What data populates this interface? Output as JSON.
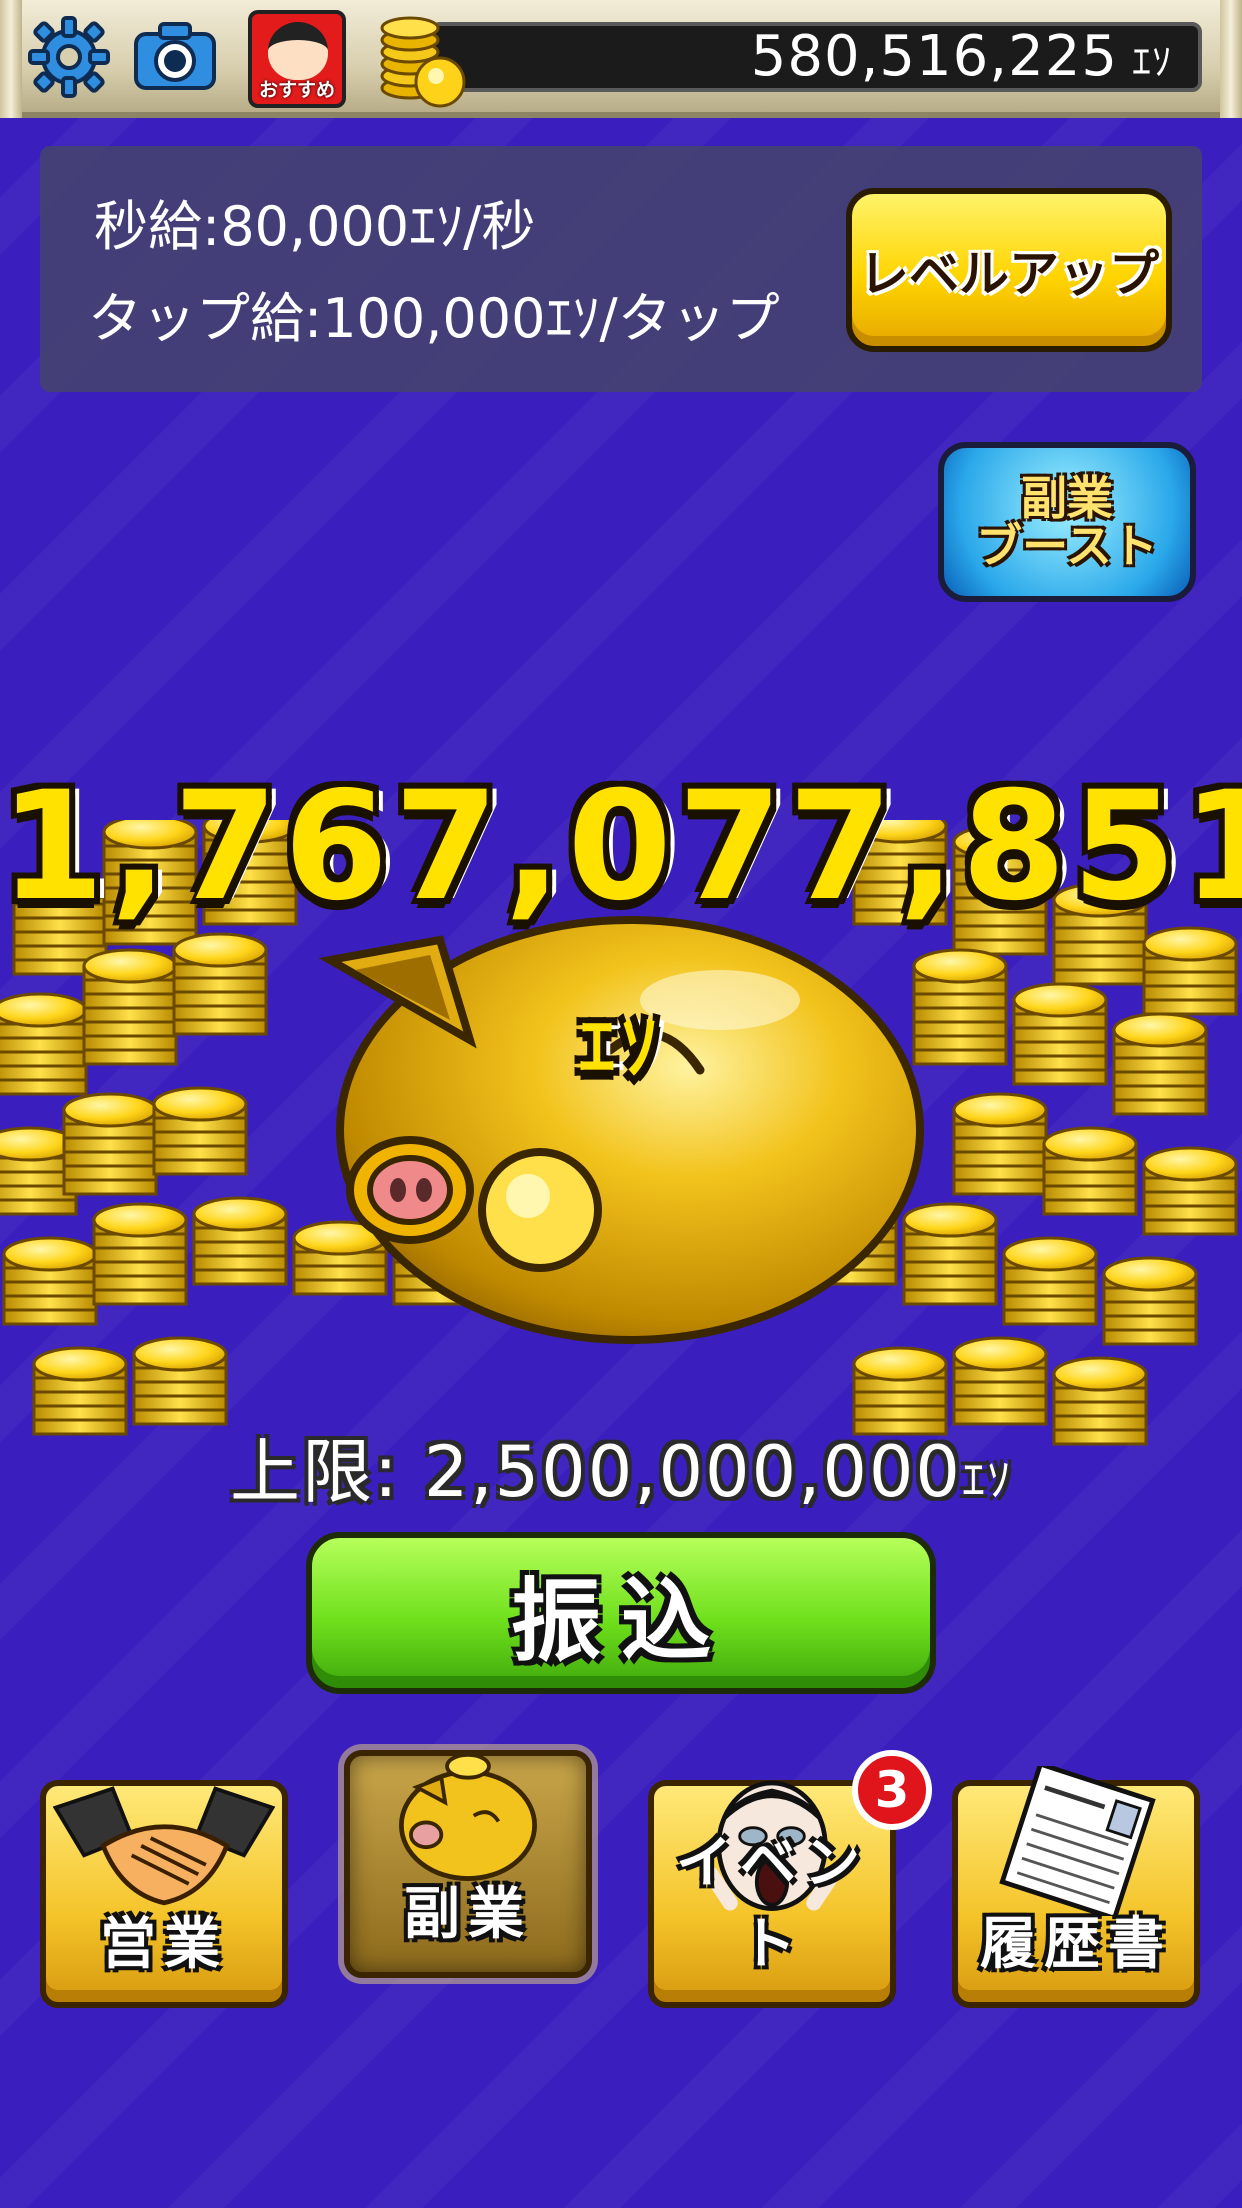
{
  "top_bar": {
    "recommend_label": "おすすめ",
    "money_value": "580,516,225",
    "money_unit": "ｴｿ"
  },
  "stats": {
    "per_second": "秒給:80,000ｴｿ/秒",
    "per_tap": "タップ給:100,000ｴｿ/タップ",
    "level_up_label": "レベルアップ"
  },
  "boost": {
    "line1": "副業",
    "line2": "ブースト"
  },
  "main": {
    "savings_amount": "1,767,077,851",
    "savings_unit": "ｴｿ",
    "limit_text": "上限: 2,500,000,000",
    "limit_unit": "ｴｿ",
    "transfer_label": "振込"
  },
  "nav": {
    "items": [
      {
        "label": "営業",
        "icon": "handshake-icon"
      },
      {
        "label": "副業",
        "icon": "golden-pig-icon",
        "selected": true
      },
      {
        "label": "イベント",
        "icon": "screaming-man-icon"
      },
      {
        "label": "履歴書",
        "icon": "resume-document-icon"
      }
    ],
    "event_badge": "3"
  },
  "colors": {
    "background": "#3a1fbe",
    "level_up_button": "#ffd400",
    "transfer_button": "#6fe01c",
    "boost_button": "#2aa8ea",
    "amount_text": "#ffe200"
  }
}
